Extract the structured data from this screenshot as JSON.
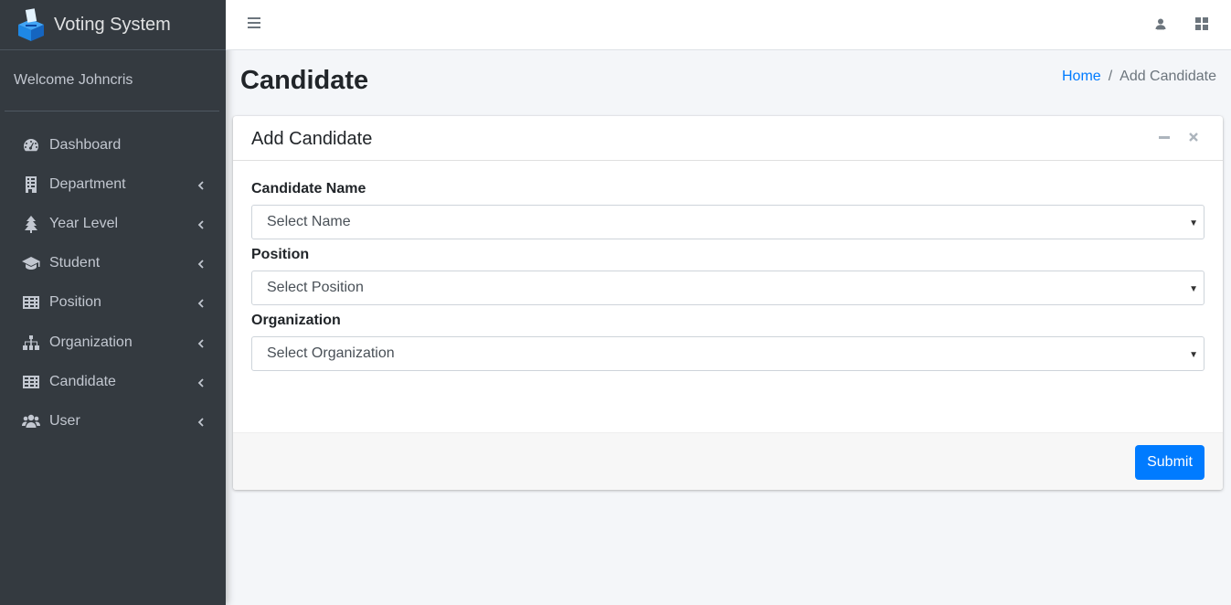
{
  "brand": {
    "name": "Voting System",
    "logo_icon": "ballot-box-icon"
  },
  "user_panel": {
    "welcome": "Welcome Johncris"
  },
  "sidebar": {
    "items": [
      {
        "label": "Dashboard",
        "icon": "tachometer-icon",
        "has_children": false
      },
      {
        "label": "Department",
        "icon": "building-icon",
        "has_children": true
      },
      {
        "label": "Year Level",
        "icon": "tree-icon",
        "has_children": true
      },
      {
        "label": "Student",
        "icon": "graduation-cap-icon",
        "has_children": true
      },
      {
        "label": "Position",
        "icon": "table-icon",
        "has_children": true
      },
      {
        "label": "Organization",
        "icon": "sitemap-icon",
        "has_children": true
      },
      {
        "label": "Candidate",
        "icon": "table-icon",
        "has_children": true
      },
      {
        "label": "User",
        "icon": "users-icon",
        "has_children": true
      }
    ]
  },
  "topbar": {
    "menu_icon": "bars-icon",
    "user_icon": "user-icon",
    "apps_icon": "th-large-icon"
  },
  "page": {
    "title": "Candidate"
  },
  "breadcrumb": {
    "home": "Home",
    "separator": "/",
    "current": "Add Candidate"
  },
  "card": {
    "title": "Add Candidate",
    "fields": {
      "candidate_name": {
        "label": "Candidate Name",
        "value": "Select Name"
      },
      "position": {
        "label": "Position",
        "value": "Select Position"
      },
      "organization": {
        "label": "Organization",
        "value": "Select Organization"
      }
    },
    "submit_label": "Submit"
  },
  "colors": {
    "sidebar_bg": "#343a40",
    "accent": "#007bff",
    "content_bg": "#f4f6f9",
    "logo_blue": "#1e88e5"
  }
}
